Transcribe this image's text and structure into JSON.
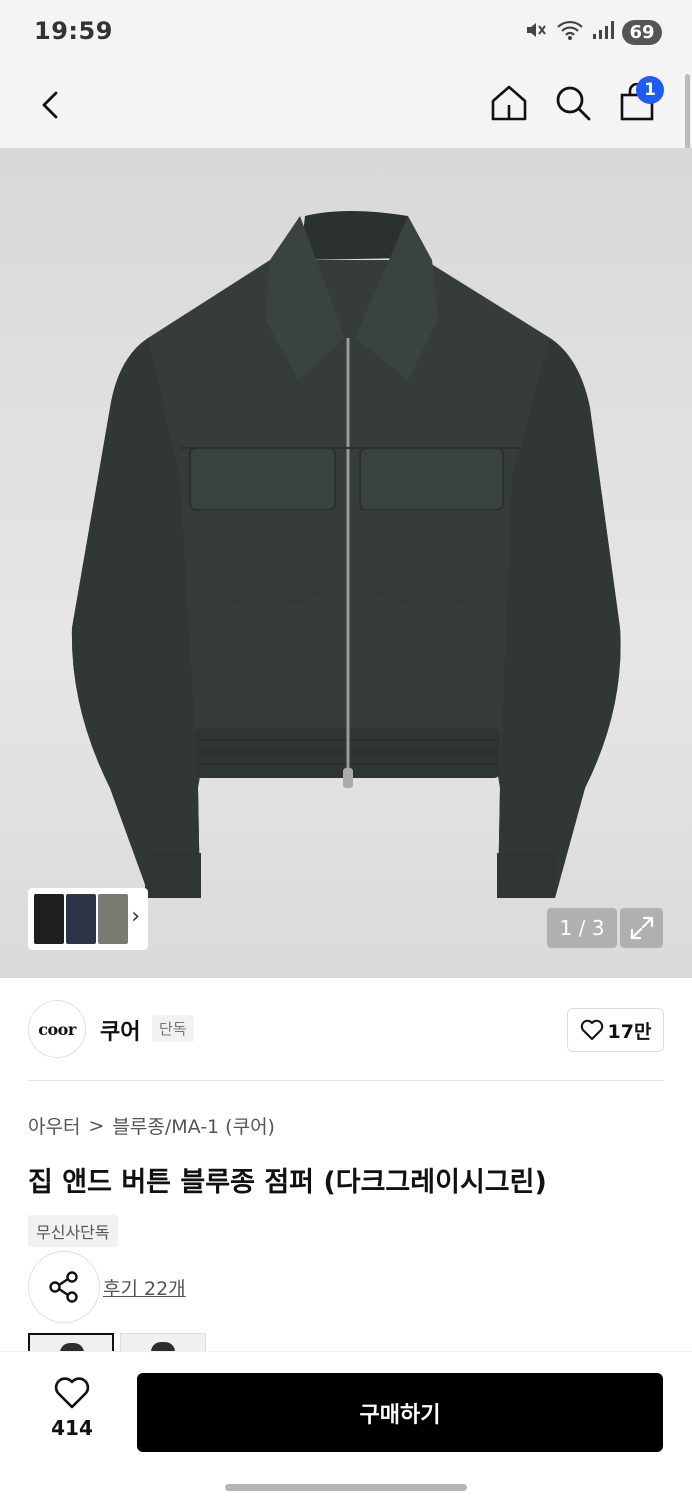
{
  "status": {
    "time": "19:59",
    "battery": "69"
  },
  "header": {
    "cart_count": "1"
  },
  "gallery": {
    "counter": "1 / 3"
  },
  "brand": {
    "logo_text": "coor",
    "name": "쿠어",
    "tag": "단독",
    "likes": "17만"
  },
  "breadcrumb": {
    "category": "아우터",
    "separator": ">",
    "subcategory": "블루종/MA-1 (쿠어)"
  },
  "product": {
    "title": "집 앤드 버튼 블루종 점퍼 (다크그레이시그린)",
    "exclusive_badge": "무신사단독",
    "review_link": "후기 22개"
  },
  "bottom": {
    "wish_count": "414",
    "buy_label": "구매하기"
  },
  "colors": {
    "accent": "#1f5cf5",
    "jacket": "#363c3c",
    "buy_button": "#000000"
  }
}
